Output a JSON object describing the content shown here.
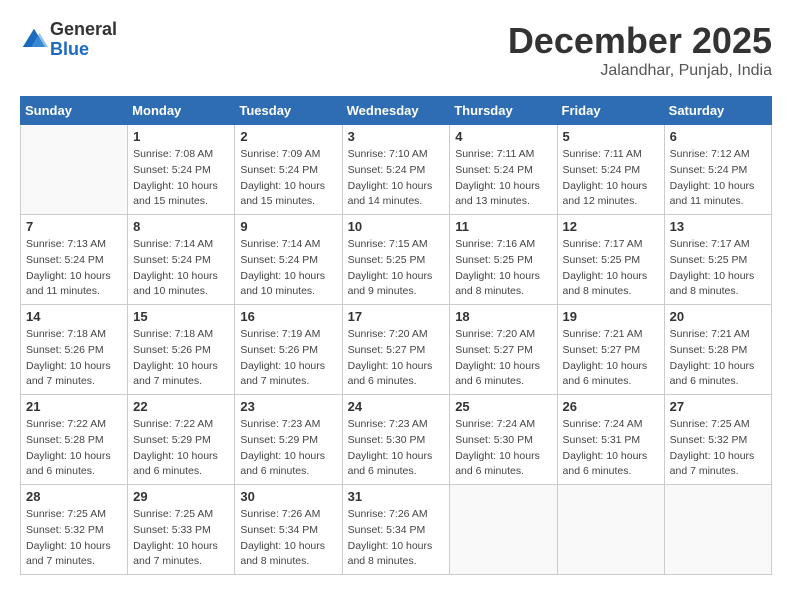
{
  "logo": {
    "general": "General",
    "blue": "Blue"
  },
  "title": "December 2025",
  "location": "Jalandhar, Punjab, India",
  "days_of_week": [
    "Sunday",
    "Monday",
    "Tuesday",
    "Wednesday",
    "Thursday",
    "Friday",
    "Saturday"
  ],
  "weeks": [
    [
      {
        "day": "",
        "info": ""
      },
      {
        "day": "1",
        "info": "Sunrise: 7:08 AM\nSunset: 5:24 PM\nDaylight: 10 hours\nand 15 minutes."
      },
      {
        "day": "2",
        "info": "Sunrise: 7:09 AM\nSunset: 5:24 PM\nDaylight: 10 hours\nand 15 minutes."
      },
      {
        "day": "3",
        "info": "Sunrise: 7:10 AM\nSunset: 5:24 PM\nDaylight: 10 hours\nand 14 minutes."
      },
      {
        "day": "4",
        "info": "Sunrise: 7:11 AM\nSunset: 5:24 PM\nDaylight: 10 hours\nand 13 minutes."
      },
      {
        "day": "5",
        "info": "Sunrise: 7:11 AM\nSunset: 5:24 PM\nDaylight: 10 hours\nand 12 minutes."
      },
      {
        "day": "6",
        "info": "Sunrise: 7:12 AM\nSunset: 5:24 PM\nDaylight: 10 hours\nand 11 minutes."
      }
    ],
    [
      {
        "day": "7",
        "info": "Sunrise: 7:13 AM\nSunset: 5:24 PM\nDaylight: 10 hours\nand 11 minutes."
      },
      {
        "day": "8",
        "info": "Sunrise: 7:14 AM\nSunset: 5:24 PM\nDaylight: 10 hours\nand 10 minutes."
      },
      {
        "day": "9",
        "info": "Sunrise: 7:14 AM\nSunset: 5:24 PM\nDaylight: 10 hours\nand 10 minutes."
      },
      {
        "day": "10",
        "info": "Sunrise: 7:15 AM\nSunset: 5:25 PM\nDaylight: 10 hours\nand 9 minutes."
      },
      {
        "day": "11",
        "info": "Sunrise: 7:16 AM\nSunset: 5:25 PM\nDaylight: 10 hours\nand 8 minutes."
      },
      {
        "day": "12",
        "info": "Sunrise: 7:17 AM\nSunset: 5:25 PM\nDaylight: 10 hours\nand 8 minutes."
      },
      {
        "day": "13",
        "info": "Sunrise: 7:17 AM\nSunset: 5:25 PM\nDaylight: 10 hours\nand 8 minutes."
      }
    ],
    [
      {
        "day": "14",
        "info": "Sunrise: 7:18 AM\nSunset: 5:26 PM\nDaylight: 10 hours\nand 7 minutes."
      },
      {
        "day": "15",
        "info": "Sunrise: 7:18 AM\nSunset: 5:26 PM\nDaylight: 10 hours\nand 7 minutes."
      },
      {
        "day": "16",
        "info": "Sunrise: 7:19 AM\nSunset: 5:26 PM\nDaylight: 10 hours\nand 7 minutes."
      },
      {
        "day": "17",
        "info": "Sunrise: 7:20 AM\nSunset: 5:27 PM\nDaylight: 10 hours\nand 6 minutes."
      },
      {
        "day": "18",
        "info": "Sunrise: 7:20 AM\nSunset: 5:27 PM\nDaylight: 10 hours\nand 6 minutes."
      },
      {
        "day": "19",
        "info": "Sunrise: 7:21 AM\nSunset: 5:27 PM\nDaylight: 10 hours\nand 6 minutes."
      },
      {
        "day": "20",
        "info": "Sunrise: 7:21 AM\nSunset: 5:28 PM\nDaylight: 10 hours\nand 6 minutes."
      }
    ],
    [
      {
        "day": "21",
        "info": "Sunrise: 7:22 AM\nSunset: 5:28 PM\nDaylight: 10 hours\nand 6 minutes."
      },
      {
        "day": "22",
        "info": "Sunrise: 7:22 AM\nSunset: 5:29 PM\nDaylight: 10 hours\nand 6 minutes."
      },
      {
        "day": "23",
        "info": "Sunrise: 7:23 AM\nSunset: 5:29 PM\nDaylight: 10 hours\nand 6 minutes."
      },
      {
        "day": "24",
        "info": "Sunrise: 7:23 AM\nSunset: 5:30 PM\nDaylight: 10 hours\nand 6 minutes."
      },
      {
        "day": "25",
        "info": "Sunrise: 7:24 AM\nSunset: 5:30 PM\nDaylight: 10 hours\nand 6 minutes."
      },
      {
        "day": "26",
        "info": "Sunrise: 7:24 AM\nSunset: 5:31 PM\nDaylight: 10 hours\nand 6 minutes."
      },
      {
        "day": "27",
        "info": "Sunrise: 7:25 AM\nSunset: 5:32 PM\nDaylight: 10 hours\nand 7 minutes."
      }
    ],
    [
      {
        "day": "28",
        "info": "Sunrise: 7:25 AM\nSunset: 5:32 PM\nDaylight: 10 hours\nand 7 minutes."
      },
      {
        "day": "29",
        "info": "Sunrise: 7:25 AM\nSunset: 5:33 PM\nDaylight: 10 hours\nand 7 minutes."
      },
      {
        "day": "30",
        "info": "Sunrise: 7:26 AM\nSunset: 5:34 PM\nDaylight: 10 hours\nand 8 minutes."
      },
      {
        "day": "31",
        "info": "Sunrise: 7:26 AM\nSunset: 5:34 PM\nDaylight: 10 hours\nand 8 minutes."
      },
      {
        "day": "",
        "info": ""
      },
      {
        "day": "",
        "info": ""
      },
      {
        "day": "",
        "info": ""
      }
    ]
  ]
}
